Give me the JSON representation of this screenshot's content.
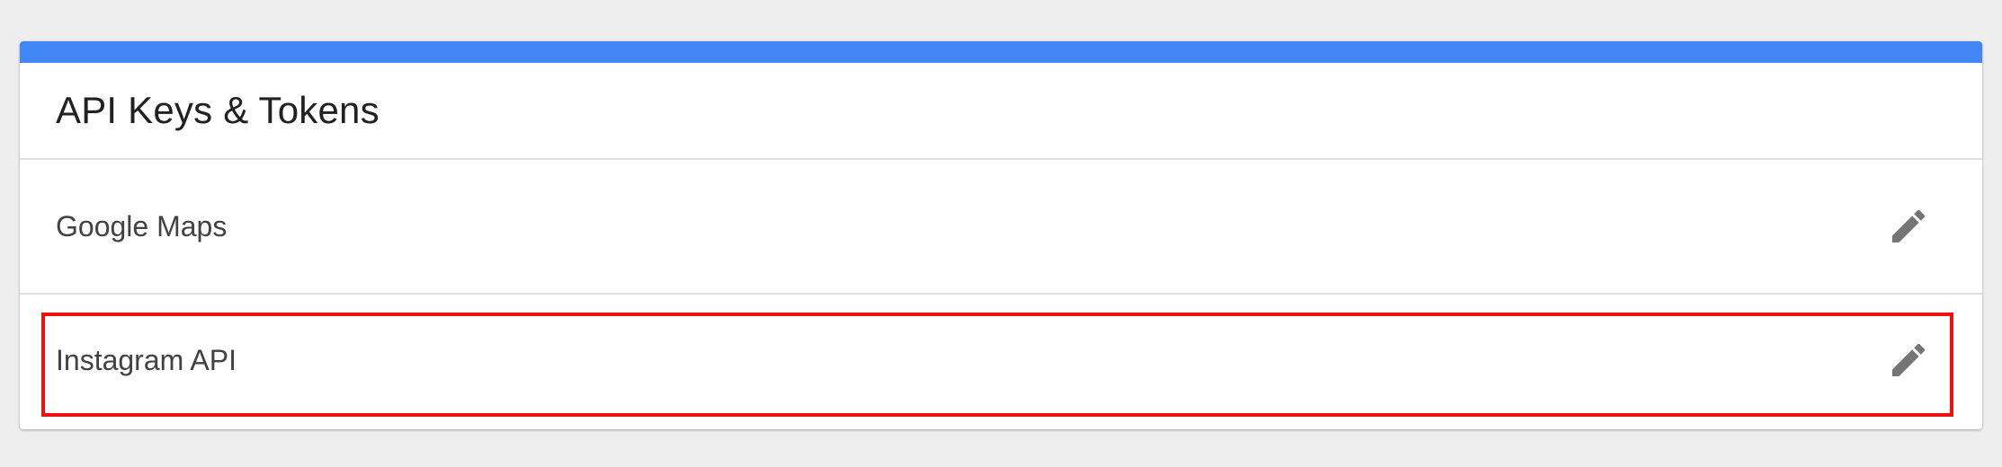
{
  "card": {
    "title": "API Keys & Tokens",
    "accent_color": "#4285f4"
  },
  "items": [
    {
      "label": "Google Maps",
      "action_icon": "pencil-icon"
    },
    {
      "label": "Instagram API",
      "action_icon": "pencil-icon"
    }
  ],
  "highlight": {
    "target": "Instagram API",
    "color": "#ee1111"
  }
}
